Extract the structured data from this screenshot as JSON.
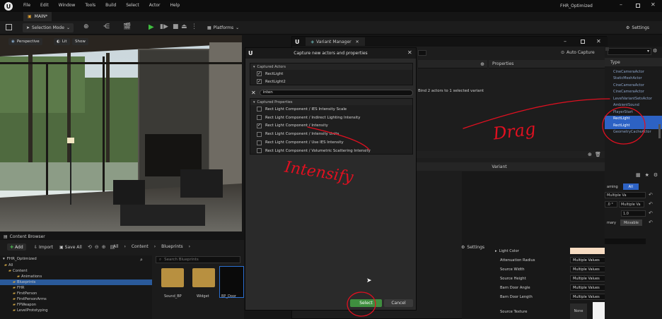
{
  "titlebar": {
    "menu": [
      "File",
      "Edit",
      "Window",
      "Tools",
      "Build",
      "Select",
      "Actor",
      "Help"
    ],
    "project_title": "FHR_Optimized",
    "tab": "MAIN*"
  },
  "toolbar": {
    "selection_mode": "Selection Mode",
    "platforms": "Platforms",
    "settings": "Settings"
  },
  "viewport": {
    "perspective": "Perspective",
    "lit": "Lit",
    "show": "Show"
  },
  "variant_manager": {
    "title": "Variant Manager",
    "auto_capture": "Auto Capture",
    "properties_header": "Properties",
    "bind_text": "Bind 2 actors to 1 selected variant",
    "variant_header": "Variant"
  },
  "dialog": {
    "title": "Capture new actors and properties",
    "captured_actors_header": "Captured Actors",
    "actors": [
      {
        "label": "RectLight",
        "checked": true
      },
      {
        "label": "RectLight2",
        "checked": true
      }
    ],
    "filter_value": "inten",
    "captured_properties_header": "Captured Properties",
    "properties": [
      {
        "label": "Rect Light Component / IES Intensity Scale",
        "checked": false
      },
      {
        "label": "Rect Light Component / Indirect Lighting Intensity",
        "checked": false
      },
      {
        "label": "Rect Light Component / Intensity",
        "checked": true
      },
      {
        "label": "Rect Light Component / Intensity Units",
        "checked": false
      },
      {
        "label": "Rect Light Component / Use IES Intensity",
        "checked": false
      },
      {
        "label": "Rect Light Component / Volumetric Scattering Intensity",
        "checked": false
      }
    ],
    "select_label": "Select",
    "cancel_label": "Cancel"
  },
  "outliner": {
    "type_header": "Type",
    "types": [
      "CineCameraActor",
      "StaticMeshActor",
      "CineCameraActor",
      "CineCameraActor",
      "LevelVariantSetsActor",
      "AmbientSound",
      "PlayerStart",
      "RectLight",
      "RectLight",
      "GeometryCacheActor"
    ],
    "tabs": {
      "naming": "aming",
      "all": "All"
    },
    "values": [
      "Multiple Va",
      "Multiple Va",
      "Multiple Va",
      "1.0"
    ],
    "first_value_prefix": ".0 °",
    "mobility": {
      "primary": "mary",
      "movable": "Movable"
    }
  },
  "details": {
    "rows": [
      {
        "label": "Light Color",
        "value": ""
      },
      {
        "label": "Attenuation Radius",
        "value": "Multiple Values"
      },
      {
        "label": "Source Width",
        "value": "Multiple Values"
      },
      {
        "label": "Source Height",
        "value": "Multiple Values"
      },
      {
        "label": "Barn Door Angle",
        "value": "Multiple Values"
      },
      {
        "label": "Barn Door Length",
        "value": "Multiple Values"
      },
      {
        "label": "Source Texture",
        "value": "None"
      }
    ],
    "light_color_hex": "#f7dcc2"
  },
  "content_browser": {
    "title": "Content Browser",
    "add": "Add",
    "import": "Import",
    "save_all": "Save All",
    "settings": "Settings",
    "breadcrumb": [
      "All",
      "Content",
      "Blueprints"
    ],
    "tree_root": "FHR_Optimized",
    "tree": [
      "All",
      "Content",
      "Animations",
      "Blueprints",
      "FHR",
      "FirstPerson",
      "FirstPersonArms",
      "FPWeapon",
      "LevelPrototyping"
    ],
    "search_placeholder": "Search Blueprints",
    "assets": [
      "Sound_BP",
      "Widget",
      "BP_Door"
    ]
  },
  "annotations": {
    "intensify": "Intensify",
    "drag": "Drag",
    "color": "#e01020"
  }
}
